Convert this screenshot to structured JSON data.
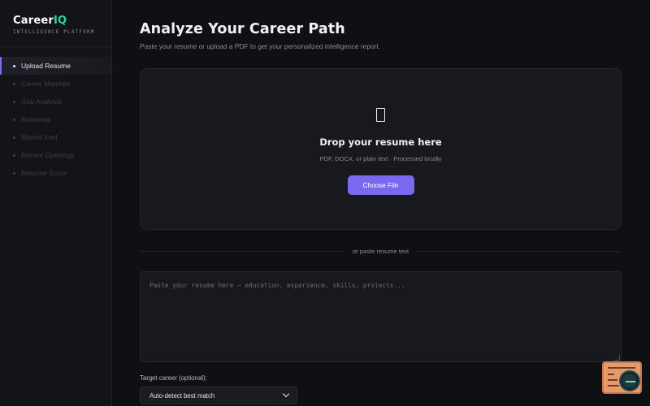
{
  "brand": {
    "name_main": "Career",
    "name_accent": "IQ",
    "tagline": "INTELLIGENCE PLATFORM"
  },
  "sidebar": {
    "items": [
      {
        "label": "Upload Resume",
        "active": true
      },
      {
        "label": "Career Matches",
        "active": false
      },
      {
        "label": "Gap Analysis",
        "active": false
      },
      {
        "label": "Roadmap",
        "active": false
      },
      {
        "label": "Market Intel",
        "active": false
      },
      {
        "label": "Recent Openings",
        "active": false
      },
      {
        "label": "Resume Score",
        "active": false
      }
    ]
  },
  "main": {
    "title": "Analyze Your Career Path",
    "subtitle": "Paste your resume or upload a PDF to get your personalized intelligence report."
  },
  "dropzone": {
    "title": "Drop your resume here",
    "subtitle": "PDF, DOCX, or plain text · Processed locally",
    "button_label": "Choose File",
    "icon": "document-icon"
  },
  "divider": {
    "text": "or paste resume text"
  },
  "paste": {
    "placeholder": "Paste your resume here — education, experience, skills, projects...",
    "value": ""
  },
  "target": {
    "label": "Target career (optional):",
    "selected": "Auto-detect best match"
  },
  "colors": {
    "background": "#0f1013",
    "accent": "#7a69f0",
    "brand_accent": "#2fd89a"
  }
}
